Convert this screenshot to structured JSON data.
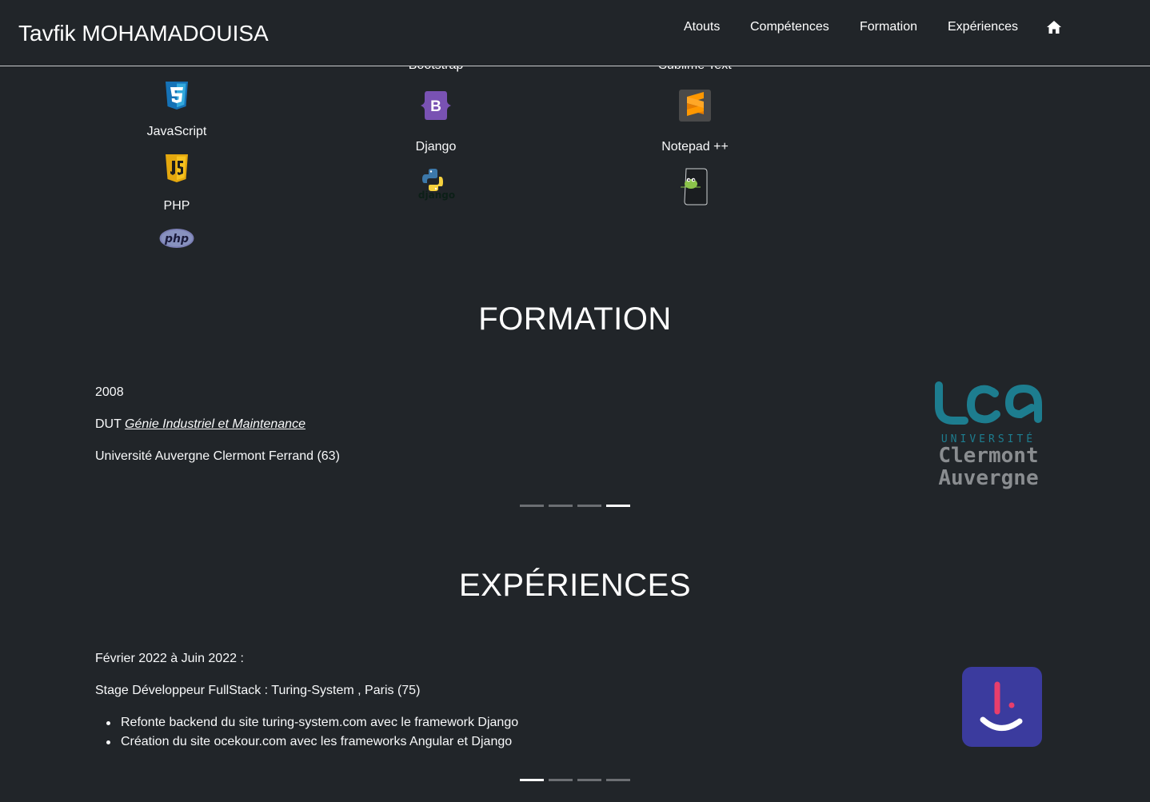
{
  "navbar": {
    "brand": "Tavfik MOHAMADOUISA",
    "links": [
      "Atouts",
      "Compétences",
      "Formation",
      "Expériences"
    ],
    "home_icon": "home-icon"
  },
  "skills": {
    "cutoff": [
      "Bootstrap",
      "Sublime Text"
    ],
    "col1": {
      "labels": [
        "JavaScript",
        "PHP"
      ],
      "icons": [
        "css3-icon",
        "javascript-icon",
        "php-icon"
      ]
    },
    "col2": {
      "labels": [
        "Django"
      ],
      "icons": [
        "bootstrap-icon",
        "django-icon"
      ]
    },
    "col3": {
      "labels": [
        "Notepad ++"
      ],
      "icons": [
        "sublime-text-icon",
        "notepad-plus-plus-icon"
      ]
    },
    "php_logo_text": "php",
    "bootstrap_logo_text": "B",
    "django_logo_text": "django"
  },
  "formation": {
    "title": "FORMATION",
    "year": "2008",
    "degree_prefix": "DUT ",
    "degree_link": "Génie Industriel et Maintenance",
    "school": "Université Auvergne Clermont Ferrand (63)",
    "logo": {
      "word1": "UNIVERSITÉ",
      "word2": "Clermont",
      "word3": "Auvergne",
      "teal": "#1d7d8f"
    },
    "indicator_count": 4,
    "active_indicator": 4
  },
  "experiences": {
    "title": "EXPÉRIENCES",
    "period": "Février 2022 à Juin 2022 :",
    "role": "Stage Développeur FullStack : Turing-System , Paris (75)",
    "bullets": [
      "Refonte backend du site turing-system.com avec le framework Django",
      "Création du site ocekour.com avec les frameworks Angular et Django"
    ],
    "logo_bg": "#3b3b9e",
    "indicator_count": 4,
    "active_indicator": 1
  },
  "colors": {
    "background": "#212529",
    "text": "#f8f9fa",
    "indicator_inactive": "#6c6f73",
    "indicator_active": "#ffffff"
  }
}
